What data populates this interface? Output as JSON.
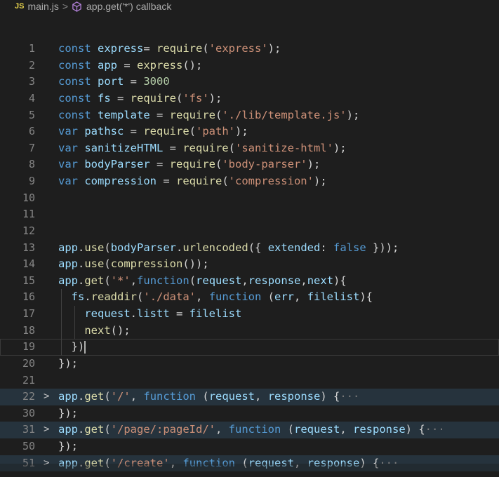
{
  "breadcrumb": {
    "file_badge": "JS",
    "file": "main.js",
    "symbol": "app.get('*') callback",
    "separator": ">"
  },
  "editor": {
    "fold_marker": ">",
    "fold_ellipsis": "···",
    "lines": [
      {
        "n": "1",
        "tokens": [
          [
            "kw",
            "const "
          ],
          [
            "var",
            "express"
          ],
          [
            "",
            "= "
          ],
          [
            "fn",
            "require"
          ],
          [
            "",
            "("
          ],
          [
            "str",
            "'express'"
          ],
          [
            "",
            ");"
          ]
        ]
      },
      {
        "n": "2",
        "tokens": [
          [
            "kw",
            "const "
          ],
          [
            "var",
            "app"
          ],
          [
            "",
            " = "
          ],
          [
            "fn",
            "express"
          ],
          [
            "",
            "();"
          ]
        ]
      },
      {
        "n": "3",
        "tokens": [
          [
            "kw",
            "const "
          ],
          [
            "var",
            "port"
          ],
          [
            "",
            " = "
          ],
          [
            "num",
            "3000"
          ]
        ]
      },
      {
        "n": "4",
        "tokens": [
          [
            "kw",
            "const "
          ],
          [
            "var",
            "fs"
          ],
          [
            "",
            " = "
          ],
          [
            "fn",
            "require"
          ],
          [
            "",
            "("
          ],
          [
            "str",
            "'fs'"
          ],
          [
            "",
            ");"
          ]
        ]
      },
      {
        "n": "5",
        "tokens": [
          [
            "kw",
            "const "
          ],
          [
            "var",
            "template"
          ],
          [
            "",
            " = "
          ],
          [
            "fn",
            "require"
          ],
          [
            "",
            "("
          ],
          [
            "str",
            "'./lib/template.js'"
          ],
          [
            "",
            ");"
          ]
        ]
      },
      {
        "n": "6",
        "tokens": [
          [
            "kw",
            "var "
          ],
          [
            "var",
            "pathsc"
          ],
          [
            "",
            " = "
          ],
          [
            "fn",
            "require"
          ],
          [
            "",
            "("
          ],
          [
            "str",
            "'path'"
          ],
          [
            "",
            ");"
          ]
        ]
      },
      {
        "n": "7",
        "tokens": [
          [
            "kw",
            "var "
          ],
          [
            "var",
            "sanitizeHTML"
          ],
          [
            "",
            " = "
          ],
          [
            "fn",
            "require"
          ],
          [
            "",
            "("
          ],
          [
            "str",
            "'sanitize-html'"
          ],
          [
            "",
            ");"
          ]
        ]
      },
      {
        "n": "8",
        "tokens": [
          [
            "kw",
            "var "
          ],
          [
            "var",
            "bodyParser"
          ],
          [
            "",
            " = "
          ],
          [
            "fn",
            "require"
          ],
          [
            "",
            "("
          ],
          [
            "str",
            "'body-parser'"
          ],
          [
            "",
            ");"
          ]
        ]
      },
      {
        "n": "9",
        "tokens": [
          [
            "kw",
            "var "
          ],
          [
            "var",
            "compression"
          ],
          [
            "",
            " = "
          ],
          [
            "fn",
            "require"
          ],
          [
            "",
            "("
          ],
          [
            "str",
            "'compression'"
          ],
          [
            "",
            ");"
          ]
        ]
      },
      {
        "n": "10",
        "tokens": []
      },
      {
        "n": "11",
        "tokens": []
      },
      {
        "n": "12",
        "tokens": []
      },
      {
        "n": "13",
        "tokens": [
          [
            "var",
            "app"
          ],
          [
            "",
            "."
          ],
          [
            "fn",
            "use"
          ],
          [
            "",
            "("
          ],
          [
            "var",
            "bodyParser"
          ],
          [
            "",
            "."
          ],
          [
            "fn",
            "urlencoded"
          ],
          [
            "",
            "({ "
          ],
          [
            "var",
            "extended"
          ],
          [
            "",
            ": "
          ],
          [
            "kw",
            "false"
          ],
          [
            "",
            " }));"
          ]
        ]
      },
      {
        "n": "14",
        "tokens": [
          [
            "var",
            "app"
          ],
          [
            "",
            "."
          ],
          [
            "fn",
            "use"
          ],
          [
            "",
            "("
          ],
          [
            "fn",
            "compression"
          ],
          [
            "",
            "());"
          ]
        ]
      },
      {
        "n": "15",
        "tokens": [
          [
            "var",
            "app"
          ],
          [
            "",
            "."
          ],
          [
            "fn",
            "get"
          ],
          [
            "",
            "("
          ],
          [
            "str",
            "'*'"
          ],
          [
            "",
            ","
          ],
          [
            "kw",
            "function"
          ],
          [
            "",
            "("
          ],
          [
            "var",
            "request"
          ],
          [
            "",
            ","
          ],
          [
            "var",
            "response"
          ],
          [
            "",
            ","
          ],
          [
            "var",
            "next"
          ],
          [
            "",
            "){"
          ]
        ]
      },
      {
        "n": "16",
        "guides": 1,
        "tokens": [
          [
            "",
            "  "
          ],
          [
            "var",
            "fs"
          ],
          [
            "",
            "."
          ],
          [
            "fn",
            "readdir"
          ],
          [
            "",
            "("
          ],
          [
            "str",
            "'./data'"
          ],
          [
            "",
            ", "
          ],
          [
            "kw",
            "function"
          ],
          [
            "",
            " ("
          ],
          [
            "var",
            "err"
          ],
          [
            "",
            ", "
          ],
          [
            "var",
            "filelist"
          ],
          [
            "",
            "){"
          ]
        ]
      },
      {
        "n": "17",
        "guides": 2,
        "tokens": [
          [
            "",
            "    "
          ],
          [
            "var",
            "request"
          ],
          [
            "",
            "."
          ],
          [
            "var",
            "listt"
          ],
          [
            "",
            " = "
          ],
          [
            "var",
            "filelist"
          ]
        ]
      },
      {
        "n": "18",
        "guides": 2,
        "tokens": [
          [
            "",
            "    "
          ],
          [
            "fn",
            "next"
          ],
          [
            "",
            "();"
          ]
        ]
      },
      {
        "n": "19",
        "guides": 1,
        "active": true,
        "tokens": [
          [
            "",
            "  })"
          ]
        ]
      },
      {
        "n": "20",
        "tokens": [
          [
            "",
            "});"
          ]
        ]
      },
      {
        "n": "21",
        "tokens": []
      },
      {
        "n": "22",
        "folded": true,
        "tokens": [
          [
            "var",
            "app"
          ],
          [
            "",
            "."
          ],
          [
            "fn",
            "get"
          ],
          [
            "",
            "("
          ],
          [
            "str",
            "'/'"
          ],
          [
            "",
            ", "
          ],
          [
            "kw",
            "function"
          ],
          [
            "",
            " ("
          ],
          [
            "var",
            "request"
          ],
          [
            "",
            ", "
          ],
          [
            "var",
            "response"
          ],
          [
            "",
            ") {"
          ]
        ]
      },
      {
        "n": "30",
        "tokens": [
          [
            "",
            "});"
          ]
        ]
      },
      {
        "n": "31",
        "folded": true,
        "tokens": [
          [
            "var",
            "app"
          ],
          [
            "",
            "."
          ],
          [
            "fn",
            "get"
          ],
          [
            "",
            "("
          ],
          [
            "str",
            "'/page/:pageId/'"
          ],
          [
            "",
            ", "
          ],
          [
            "kw",
            "function"
          ],
          [
            "",
            " ("
          ],
          [
            "var",
            "request"
          ],
          [
            "",
            ", "
          ],
          [
            "var",
            "response"
          ],
          [
            "",
            ") {"
          ]
        ]
      },
      {
        "n": "50",
        "tokens": [
          [
            "",
            "});"
          ]
        ]
      },
      {
        "n": "51",
        "folded": true,
        "tokens": [
          [
            "var",
            "app"
          ],
          [
            "",
            "."
          ],
          [
            "fn",
            "get"
          ],
          [
            "",
            "("
          ],
          [
            "str",
            "'/create'"
          ],
          [
            "",
            ", "
          ],
          [
            "kw",
            "function"
          ],
          [
            "",
            " ("
          ],
          [
            "var",
            "request"
          ],
          [
            "",
            ", "
          ],
          [
            "var",
            "response"
          ],
          [
            "",
            ") {"
          ]
        ]
      }
    ]
  }
}
